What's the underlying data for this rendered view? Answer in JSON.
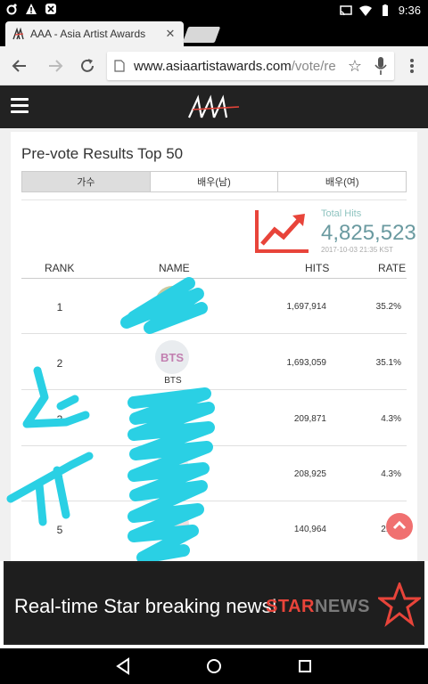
{
  "status_bar": {
    "time": "9:36",
    "icons": [
      "circle-indicator-icon",
      "warning-icon",
      "app-notification-icon",
      "cast-icon",
      "wifi-icon",
      "battery-icon"
    ]
  },
  "browser": {
    "tab_title": "AAA - Asia Artist Awards",
    "url_host": "www.asiaartistawards.com",
    "url_path": "/vote/re",
    "icons": [
      "back-icon",
      "forward-icon",
      "reload-icon",
      "page-icon",
      "star-icon",
      "mic-icon",
      "menu-icon",
      "close-icon"
    ]
  },
  "site": {
    "logo_text": "AAA",
    "section_title": "Pre-vote Results Top 50",
    "category_tabs": [
      "가수",
      "배우(남)",
      "배우(여)"
    ],
    "selected_tab": 0,
    "total_hits_label": "Total Hits",
    "total_hits_value": "4,825,523",
    "total_hits_date": "2017-10-03 21:35 KST",
    "columns": {
      "rank": "RANK",
      "name": "NAME",
      "hits": "HITS",
      "rate": "RATE"
    },
    "rows": [
      {
        "rank": "1",
        "avatar": "",
        "name": "",
        "hits": "1,697,914",
        "rate": "35.2%"
      },
      {
        "rank": "2",
        "avatar": "BTS",
        "name": "BTS",
        "hits": "1,693,059",
        "rate": "35.1%"
      },
      {
        "rank": "3",
        "avatar": "",
        "name": "",
        "hits": "209,871",
        "rate": "4.3%"
      },
      {
        "rank": "4",
        "avatar": "",
        "name": "",
        "hits": "208,925",
        "rate": "4.3%"
      },
      {
        "rank": "5",
        "avatar": "",
        "name": "",
        "hits": "140,964",
        "rate": "2.9%"
      }
    ]
  },
  "ad": {
    "text": "Real-time Star breaking news!",
    "brand_a": "STAR",
    "brand_b": "NEWS"
  },
  "colors": {
    "accent_red": "#e8443a",
    "teal": "#6a9aa0",
    "scribble": "#2ad0e4"
  }
}
